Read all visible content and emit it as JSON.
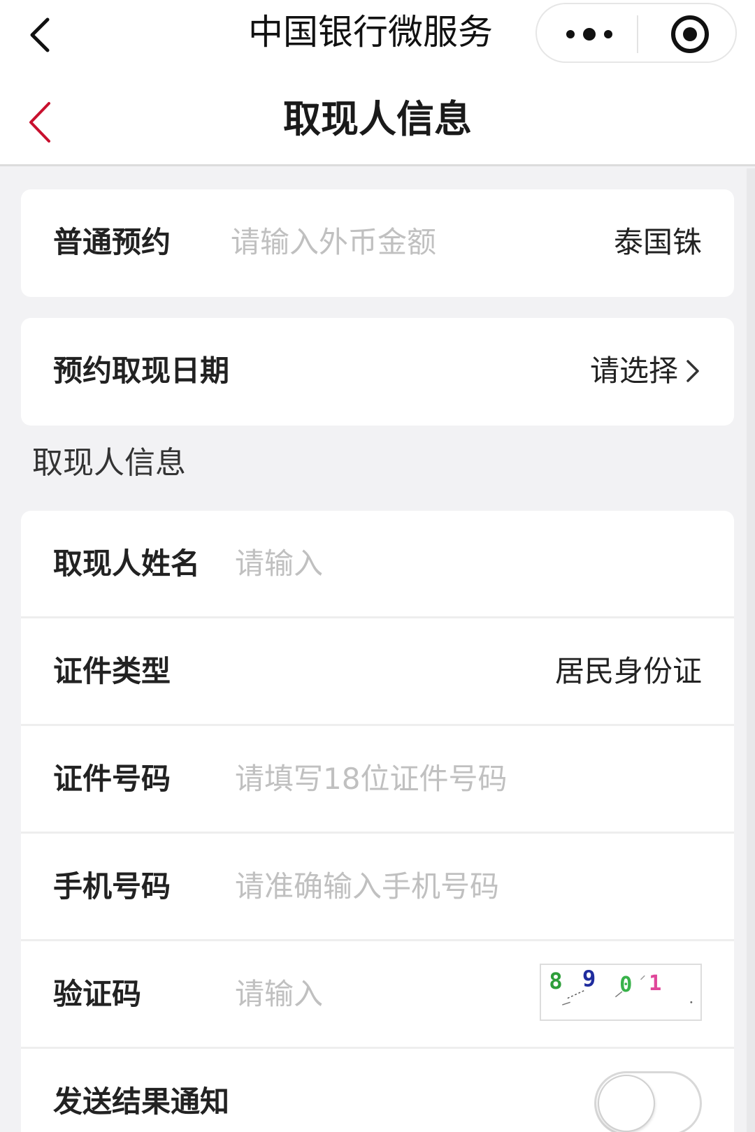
{
  "system_bar": {
    "title": "中国银行微服务",
    "back_icon": "chevron-left-icon",
    "more_icon": "more-dots-icon",
    "close_icon": "target-close-icon"
  },
  "header": {
    "title": "取现人信息",
    "back_icon": "chevron-left-icon",
    "accent_color": "#c8102e"
  },
  "booking": {
    "label": "普通预约",
    "amount_placeholder": "请输入外币金额",
    "currency": "泰国铢"
  },
  "date": {
    "label": "预约取现日期",
    "value": "请选择"
  },
  "section": {
    "title": "取现人信息"
  },
  "form": {
    "name": {
      "label": "取现人姓名",
      "placeholder": "请输入"
    },
    "id_type": {
      "label": "证件类型",
      "value": "居民身份证"
    },
    "id_number": {
      "label": "证件号码",
      "placeholder": "请填写18位证件号码"
    },
    "phone": {
      "label": "手机号码",
      "placeholder": "请准确输入手机号码"
    },
    "captcha": {
      "label": "验证码",
      "placeholder": "请输入",
      "chars": [
        "8",
        "9",
        "0",
        "1"
      ],
      "char_colors": [
        "#2e9e3a",
        "#1f2c9e",
        "#38b24a",
        "#e0479a"
      ]
    },
    "notify": {
      "label": "发送结果通知",
      "enabled": false
    }
  }
}
